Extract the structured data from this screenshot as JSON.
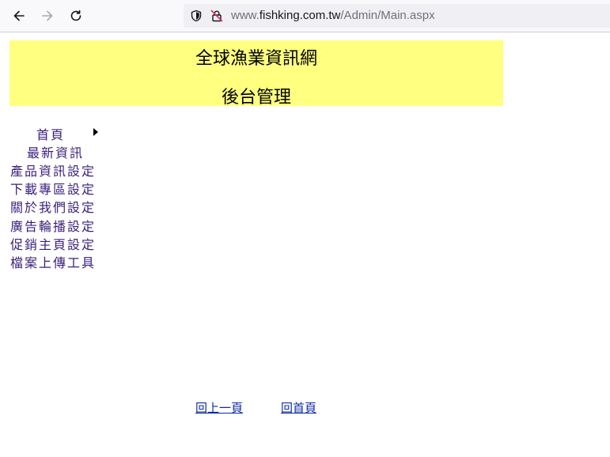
{
  "browser": {
    "url_prefix": "www.",
    "url_host": "fishking.com.tw",
    "url_path": "/Admin/Main.aspx"
  },
  "header": {
    "title": "全球漁業資訊網",
    "subtitle": "後台管理"
  },
  "menu": {
    "items": [
      {
        "label": "首頁"
      },
      {
        "label": "最新資訊"
      },
      {
        "label": "產品資訊設定"
      },
      {
        "label": "下載專區設定"
      },
      {
        "label": "關於我們設定"
      },
      {
        "label": "廣告輪播設定"
      },
      {
        "label": "促銷主頁設定"
      },
      {
        "label": "檔案上傳工具"
      }
    ]
  },
  "footer": {
    "back_label": "回上一頁",
    "home_label": "回首頁"
  },
  "colors": {
    "banner": "#ffff80",
    "menu_text": "#3a1f7a",
    "link": "#0b2aa6"
  }
}
